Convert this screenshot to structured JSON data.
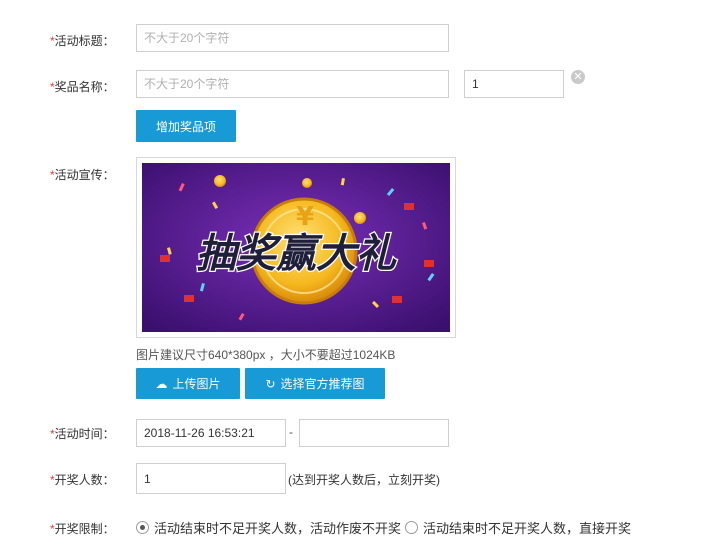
{
  "form": {
    "title": {
      "req": "*",
      "label": "活动标题：",
      "placeholder": "不大于20个字符",
      "value": ""
    },
    "prize": {
      "req": "*",
      "label": "奖品名称：",
      "placeholder": "不大于20个字符",
      "quantity": "1",
      "clear_glyph": "✕",
      "add_label": "增加奖品项"
    },
    "promo": {
      "req": "*",
      "label": "活动宣传：",
      "banner_text": "抽奖赢大礼",
      "hint": "图片建议尺寸640*380px ，大小不要超过1024KB",
      "upload_icon": "☁",
      "upload_label": "上传图片",
      "choose_icon": "↻",
      "choose_label": "选择官方推荐图"
    },
    "time": {
      "req": "*",
      "label": "活动时间：",
      "start": "2018-11-26 16:53:21",
      "separator": "-",
      "end": ""
    },
    "participants": {
      "req": "*",
      "label": "开奖人数：",
      "value": "1",
      "note": "(达到开奖人数后，立刻开奖)"
    },
    "limit": {
      "req": "*",
      "label": "开奖限制：",
      "options": [
        {
          "label": "活动结束时不足开奖人数，活动作废不开奖",
          "checked": true
        },
        {
          "label": "活动结束时不足开奖人数，直接开奖",
          "checked": false
        }
      ]
    }
  },
  "colors": {
    "accent": "#189ad6",
    "required": "#e4393c",
    "banner_bg": "#4b1585",
    "coin": "#f5b81e"
  },
  "icons": [
    "clear-circle-icon",
    "cloud-upload-icon",
    "refresh-icon",
    "coin-icon"
  ]
}
